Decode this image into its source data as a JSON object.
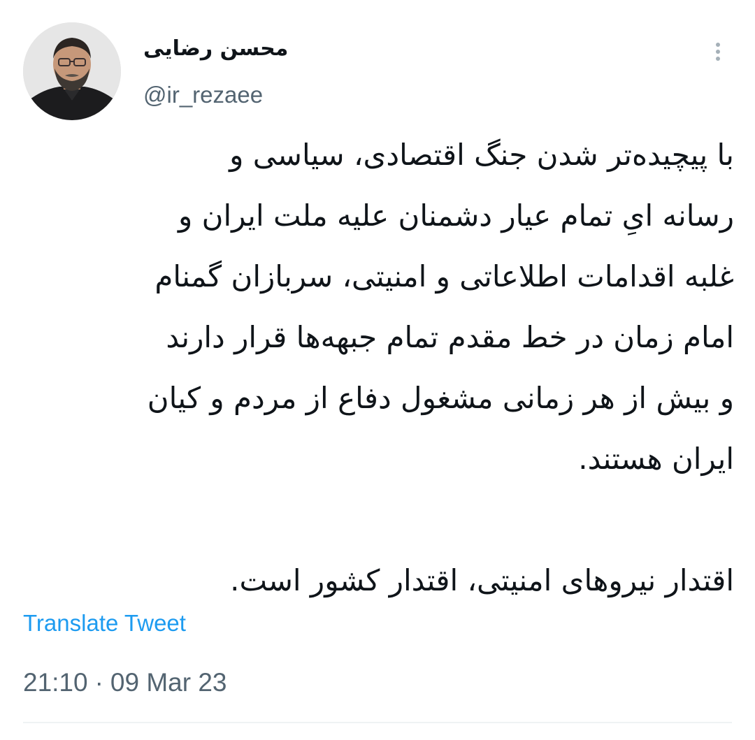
{
  "author": {
    "display_name": "محسن رضایی",
    "handle": "@ir_rezaee",
    "avatar_icon": "profile-photo"
  },
  "tweet": {
    "text": "با پیچیده‌تر شدن جنگ اقتصادی، سیاسی و\nرسانه ایِ تمام عیار دشمنان علیه ملت ایران و\nغلبه اقدامات اطلاعاتی و امنیتی، سربازان گمنام\nامام زمان در خط مقدم تمام جبهه‌ها قرار دارند\nو بیش از هر زمانی مشغول دفاع از مردم و کیان\nایران هستند.\n\nاقتدار نیروهای امنیتی، اقتدار کشور است.",
    "translate_label": "Translate Tweet",
    "time": "21:10",
    "separator": "·",
    "date": "09 Mar 23"
  },
  "icons": {
    "more": "more-vertical-icon"
  },
  "colors": {
    "text": "#0f1419",
    "secondary": "#536471",
    "link": "#1d9bf0",
    "divider": "#eff3f4"
  }
}
